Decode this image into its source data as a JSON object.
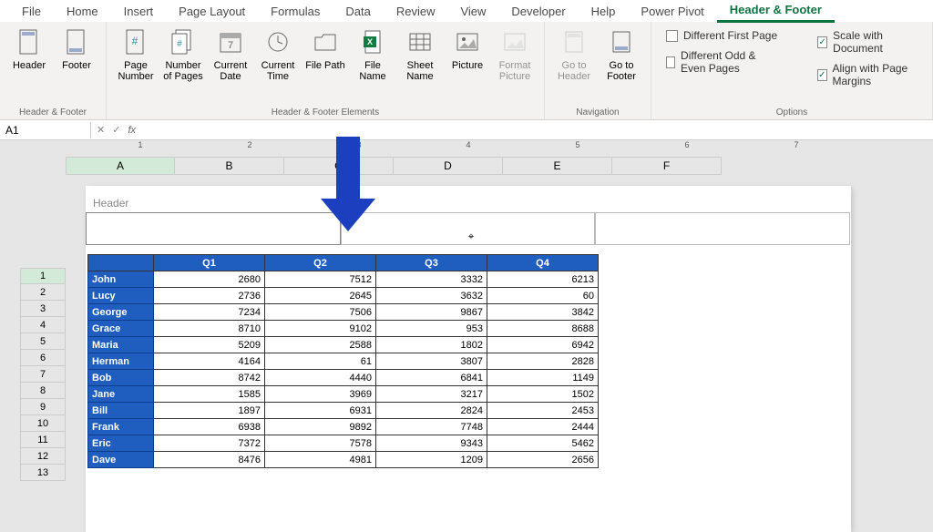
{
  "ribbon": {
    "tabs": [
      "File",
      "Home",
      "Insert",
      "Page Layout",
      "Formulas",
      "Data",
      "Review",
      "View",
      "Developer",
      "Help",
      "Power Pivot",
      "Header & Footer"
    ],
    "active_tab": "Header & Footer",
    "groups": {
      "hf": {
        "label": "Header & Footer",
        "header_btn": "Header",
        "footer_btn": "Footer"
      },
      "elements": {
        "label": "Header & Footer Elements",
        "page_number": "Page Number",
        "num_pages": "Number of Pages",
        "current_date": "Current Date",
        "current_time": "Current Time",
        "file_path": "File Path",
        "file_name": "File Name",
        "sheet_name": "Sheet Name",
        "picture": "Picture",
        "format_picture": "Format Picture"
      },
      "nav": {
        "label": "Navigation",
        "goto_header": "Go to Header",
        "goto_footer": "Go to Footer"
      },
      "options": {
        "label": "Options",
        "diff_first": "Different First Page",
        "diff_odd_even": "Different Odd & Even Pages",
        "scale": "Scale with Document",
        "align": "Align with Page Margins",
        "scale_checked": true,
        "align_checked": true,
        "diff_first_checked": false,
        "diff_odd_even_checked": false
      }
    }
  },
  "formula_bar": {
    "name_box": "A1",
    "fx": "fx"
  },
  "columns": [
    "A",
    "B",
    "C",
    "D",
    "E",
    "F"
  ],
  "ruler_marks": [
    "1",
    "2",
    "3",
    "4",
    "5",
    "6",
    "7"
  ],
  "header_section_label": "Header",
  "row_numbers": [
    "1",
    "2",
    "3",
    "4",
    "5",
    "6",
    "7",
    "8",
    "9",
    "10",
    "11",
    "12",
    "13"
  ],
  "table": {
    "headers": [
      "",
      "Q1",
      "Q2",
      "Q3",
      "Q4"
    ],
    "rows": [
      {
        "name": "John",
        "v": [
          2680,
          7512,
          3332,
          6213
        ]
      },
      {
        "name": "Lucy",
        "v": [
          2736,
          2645,
          3632,
          60
        ]
      },
      {
        "name": "George",
        "v": [
          7234,
          7506,
          9867,
          3842
        ]
      },
      {
        "name": "Grace",
        "v": [
          8710,
          9102,
          953,
          8688
        ]
      },
      {
        "name": "Maria",
        "v": [
          5209,
          2588,
          1802,
          6942
        ]
      },
      {
        "name": "Herman",
        "v": [
          4164,
          61,
          3807,
          2828
        ]
      },
      {
        "name": "Bob",
        "v": [
          8742,
          4440,
          6841,
          1149
        ]
      },
      {
        "name": "Jane",
        "v": [
          1585,
          3969,
          3217,
          1502
        ]
      },
      {
        "name": "Bill",
        "v": [
          1897,
          6931,
          2824,
          2453
        ]
      },
      {
        "name": "Frank",
        "v": [
          6938,
          9892,
          7748,
          2444
        ]
      },
      {
        "name": "Eric",
        "v": [
          7372,
          7578,
          9343,
          5462
        ]
      },
      {
        "name": "Dave",
        "v": [
          8476,
          4981,
          1209,
          2656
        ]
      }
    ]
  }
}
